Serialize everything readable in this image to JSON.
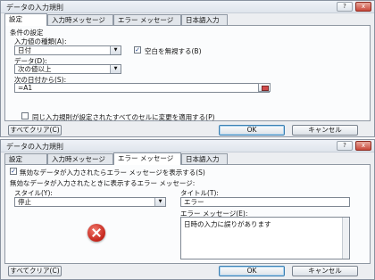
{
  "top": {
    "title": "データの入力規則",
    "tabs": [
      "設定",
      "入力時メッセージ",
      "エラー メッセージ",
      "日本語入力"
    ],
    "group_label": "条件の設定",
    "type_label": "入力値の種類(A):",
    "type_value": "日付",
    "ignore_blank_label": "空白を無視する(B)",
    "data_label": "データ(D):",
    "data_value": "次の値以上",
    "start_label": "次の日付から(S):",
    "start_value": "=A1",
    "apply_all_label": "同じ入力規則が設定されたすべてのセルに変更を適用する(P)",
    "clear_label": "すべてクリア(C)",
    "ok_label": "OK",
    "cancel_label": "キャンセル"
  },
  "bottom": {
    "title": "データの入力規則",
    "tabs": [
      "設定",
      "入力時メッセージ",
      "エラー メッセージ",
      "日本語入力"
    ],
    "show_error_label": "無効なデータが入力されたらエラー メッセージを表示する(S)",
    "when_invalid_label": "無効なデータが入力されたときに表示するエラー メッセージ:",
    "style_label": "スタイル(Y):",
    "style_value": "停止",
    "title_label": "タイトル(T):",
    "title_value": "エラー",
    "message_label": "エラー メッセージ(E):",
    "message_value": "日時の入力に誤りがあります",
    "clear_label": "すべてクリア(C)",
    "ok_label": "OK",
    "cancel_label": "キャンセル"
  },
  "glyphs": {
    "help": "?",
    "close": "x",
    "arrow": "▼",
    "check": "✓"
  }
}
